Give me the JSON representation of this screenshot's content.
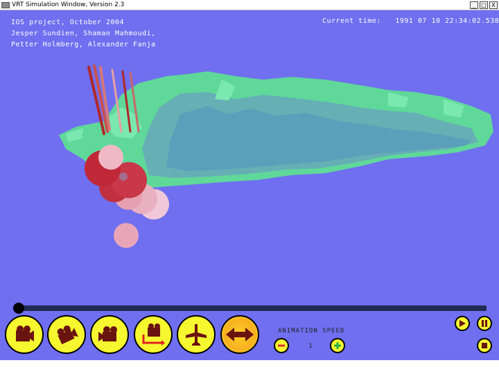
{
  "window": {
    "title": "VRT Simulation Window, Version 2.3",
    "buttons": {
      "minimize": "_",
      "maximize": "□",
      "close": "X"
    }
  },
  "overlay": {
    "credits": [
      "IOS project, October 2004",
      "Jesper Sundien, Shaman Mahmoudi,",
      "Petter Holmberg, Alexander Fanja"
    ],
    "time_label": "Current time:",
    "time_value": "1991 07 10 22:34:02.538"
  },
  "controls": {
    "speed_label": "ANIMATION SPEED",
    "speed_value": "1",
    "timeline_progress": 0.01
  },
  "colors": {
    "background": "#6f6ff0",
    "terrain": "#5fd89a",
    "button_yellow": "#f7f730",
    "minus_red": "#e03030",
    "plus_green": "#28b040",
    "icon_maroon": "#6a1410"
  },
  "icons": [
    "movie-camera-icon",
    "camera-rotate-icon",
    "camera-pan-icon",
    "camera-track-icon",
    "airplane-icon",
    "horizontal-arrows-icon",
    "minus-icon",
    "plus-icon",
    "play-icon",
    "pause-icon",
    "stop-icon"
  ]
}
